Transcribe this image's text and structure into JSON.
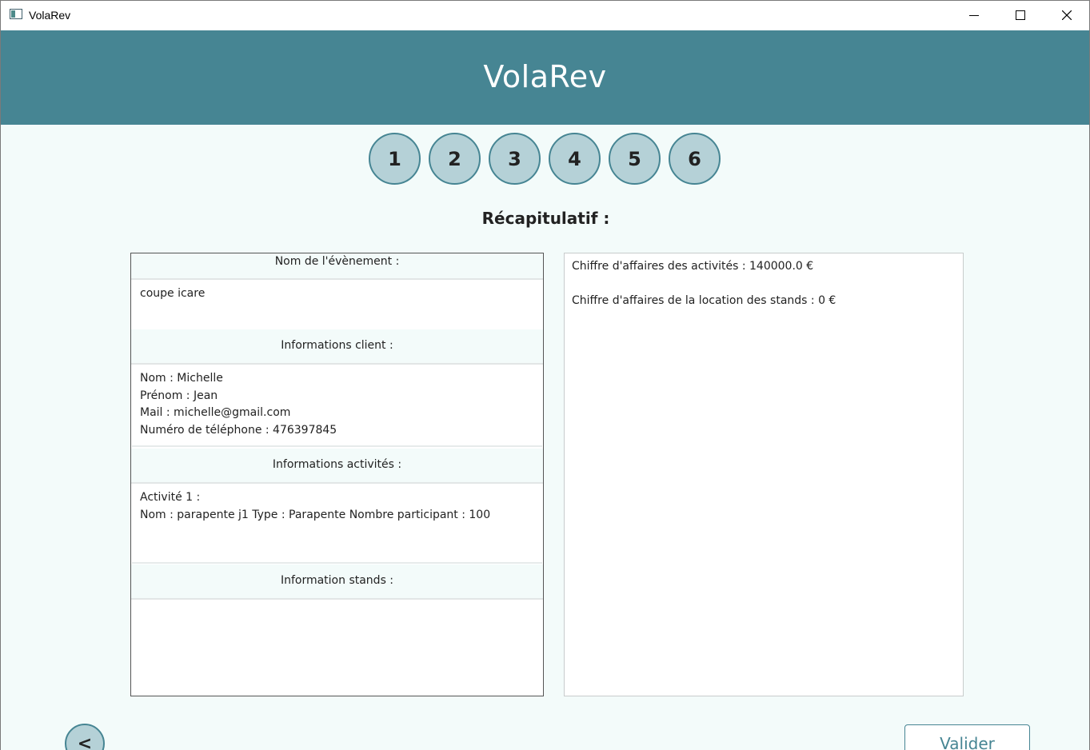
{
  "window": {
    "title": "VolaRev",
    "controls": [
      "minimize",
      "maximize",
      "close"
    ]
  },
  "header": {
    "title": "VolaRev",
    "background": "#468593"
  },
  "steps": [
    "1",
    "2",
    "3",
    "4",
    "5",
    "6"
  ],
  "recap": {
    "title": "Récapitulatif :"
  },
  "left_panel": {
    "event_header": "Nom de l'évènement :",
    "event_name": "coupe icare",
    "client_header": "Informations client :",
    "client_lines": [
      "Nom : Michelle",
      "Prénom : Jean",
      "Mail : michelle@gmail.com",
      "Numéro de téléphone : 476397845"
    ],
    "activities_header": "Informations activités :",
    "activities_lines": [
      "Activité 1 :",
      "Nom : parapente j1 Type : Parapente Nombre participant : 100"
    ],
    "stands_header": "Information stands :",
    "stands_lines": []
  },
  "right_panel": {
    "lines": [
      "Chiffre d'affaires des activités : 140000.0 €",
      "Chiffre d'affaires de la location des stands : 0 €"
    ]
  },
  "buttons": {
    "back_label": "<",
    "validate_label": "Valider"
  },
  "colors": {
    "accent": "#468593",
    "step_fill": "#b5d1d7",
    "page_bg": "#f3fbfa"
  }
}
